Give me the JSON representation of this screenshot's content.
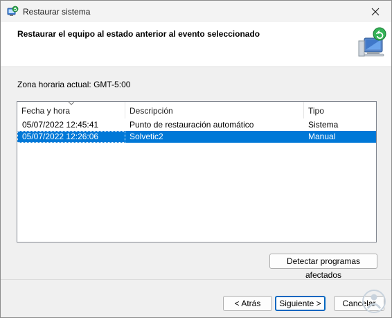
{
  "window": {
    "title": "Restaurar sistema"
  },
  "header": {
    "heading": "Restaurar el equipo al estado anterior al evento seleccionado"
  },
  "timezone_label": "Zona horaria actual: GMT-5:00",
  "table": {
    "columns": [
      "Fecha y hora",
      "Descripción",
      "Tipo"
    ],
    "rows": [
      {
        "date": "05/07/2022 12:45:41",
        "description": "Punto de restauración automático",
        "type": "Sistema",
        "selected": false
      },
      {
        "date": "05/07/2022 12:26:06",
        "description": "Solvetic2",
        "type": "Manual",
        "selected": true
      }
    ]
  },
  "buttons": {
    "detect": "Detectar programas afectados",
    "back": "< Atrás",
    "next": "Siguiente >",
    "cancel": "Cancelar"
  },
  "colors": {
    "selection": "#0078d7",
    "primary_border": "#0067c0"
  }
}
